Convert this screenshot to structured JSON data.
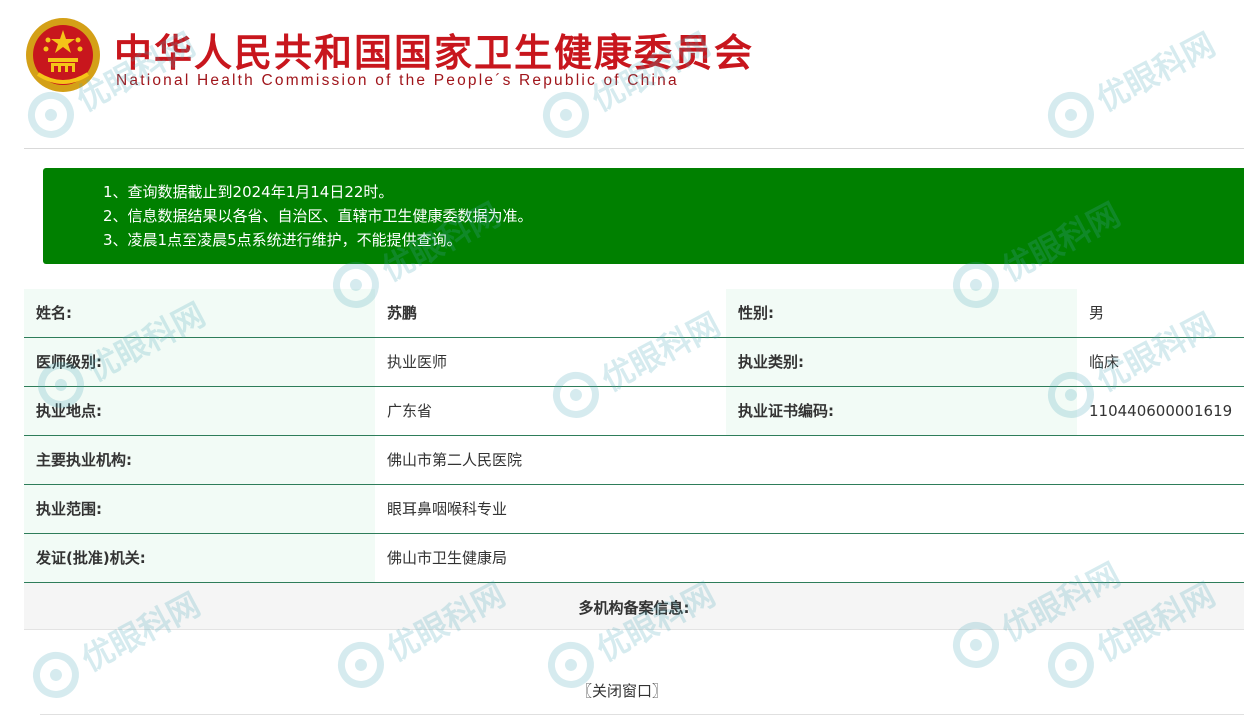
{
  "header": {
    "title_cn": "中华人民共和国国家卫生健康委员会",
    "title_en": "National Health Commission of the People´s Republic of China",
    "emblem_icon": "national-emblem-icon"
  },
  "notice": {
    "items": [
      "1、查询数据截止到2024年1月14日22时。",
      "2、信息数据结果以各省、自治区、直辖市卫生健康委数据为准。",
      "3、凌晨1点至凌晨5点系统进行维护，不能提供查询。"
    ],
    "bg_color": "#008000"
  },
  "record": {
    "name_label": "姓名:",
    "name_value": "苏鹏",
    "gender_label": "性别:",
    "gender_value": "男",
    "level_label": "医师级别:",
    "level_value": "执业医师",
    "category_label": "执业类别:",
    "category_value": "临床",
    "location_label": "执业地点:",
    "location_value": "广东省",
    "cert_label": "执业证书编码:",
    "cert_value": "110440600001619",
    "institution_label": "主要执业机构:",
    "institution_value": "佛山市第二人民医院",
    "scope_label": "执业范围:",
    "scope_value": "眼耳鼻咽喉科专业",
    "authority_label": "发证(批准)机关:",
    "authority_value": "佛山市卫生健康局"
  },
  "multi_institution": {
    "title": "多机构备案信息:"
  },
  "footer": {
    "close_label": "〖关闭窗口〗"
  },
  "watermark": {
    "text": "优眼科网",
    "icon": "eye-logo-icon"
  }
}
